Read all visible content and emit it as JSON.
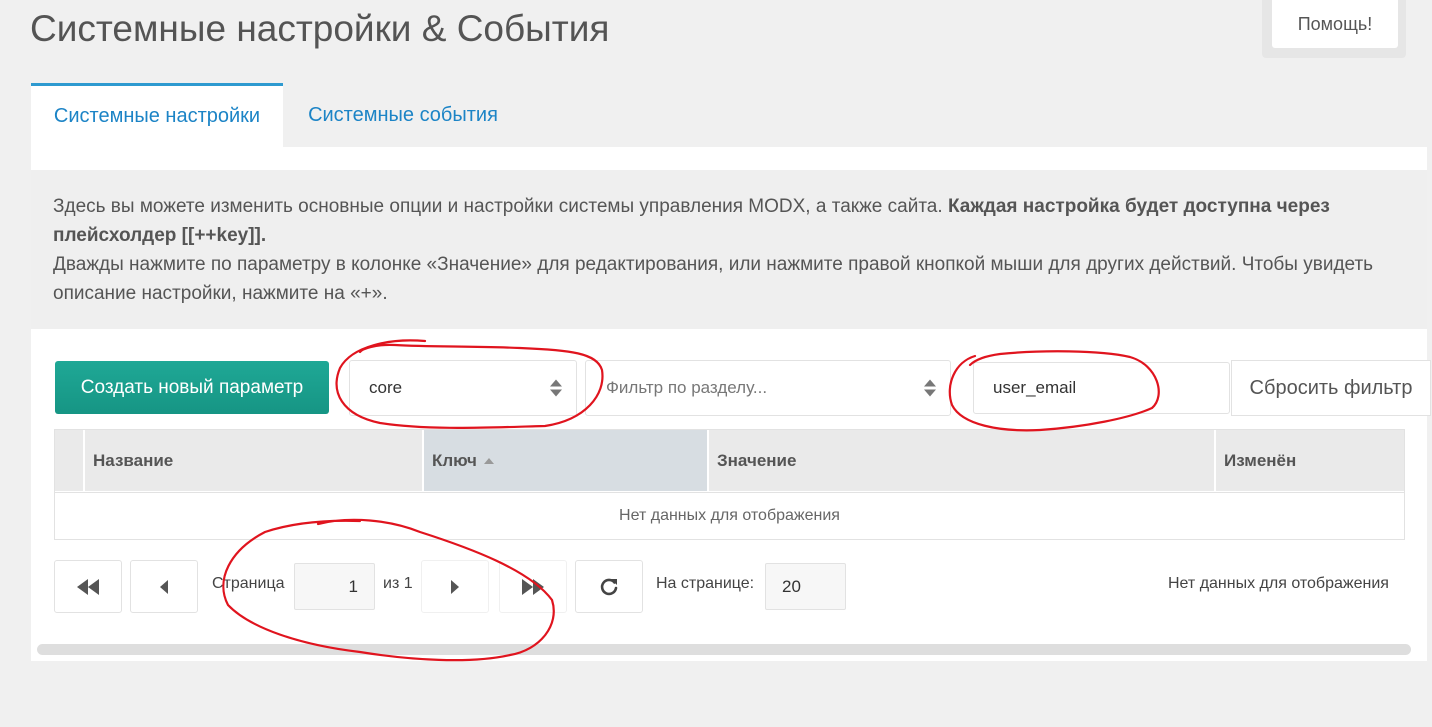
{
  "header": {
    "title": "Системные настройки & События",
    "help_label": "Помощь!"
  },
  "tabs": [
    {
      "label": "Системные настройки",
      "active": true
    },
    {
      "label": "Системные события",
      "active": false
    }
  ],
  "description": {
    "text1": "Здесь вы можете изменить основные опции и настройки системы управления MODX, а также сайта.",
    "text1_bold": "Каждая настройка будет доступна через плейсхолдер [[++key]].",
    "text2": "Дважды нажмите по параметру в колонке «Значение» для редактирования, или нажмите правой кнопкой мыши для других действий. Чтобы увидеть описание настройки, нажмите на «+»."
  },
  "toolbar": {
    "create_label": "Создать новый параметр",
    "namespace_value": "core",
    "area_placeholder": "Фильтр по разделу...",
    "search_value": "user_email",
    "reset_label": "Сбросить фильтр"
  },
  "grid": {
    "columns": [
      "Название",
      "Ключ",
      "Значение",
      "Изменён"
    ],
    "sorted_column": "Ключ",
    "empty_text": "Нет данных для отображения"
  },
  "pager": {
    "page_label": "Страница",
    "page_value": "1",
    "of_label": "из 1",
    "per_page_label": "На странице:",
    "per_page_value": "20",
    "status": "Нет данных для отображения"
  },
  "colors": {
    "accent": "#1c84c6",
    "create_button": "#1fa896",
    "annotation": "#e0141e"
  }
}
